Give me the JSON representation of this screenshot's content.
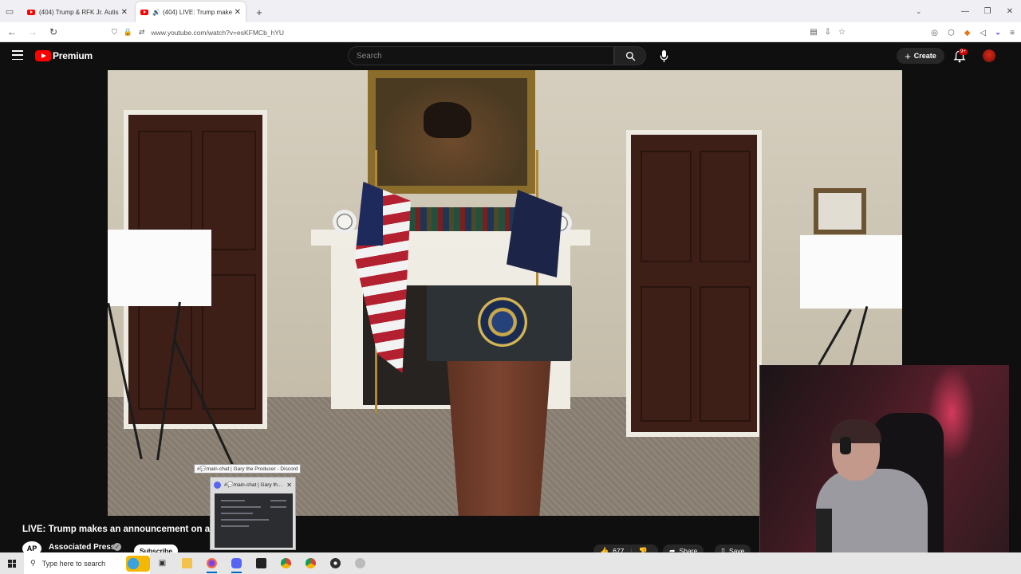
{
  "browser": {
    "tabs": [
      {
        "title": "(404) Trump & RFK Jr. Autism Ar",
        "active": false,
        "audio": false
      },
      {
        "title": "(404) LIVE: Trump makes an",
        "active": true,
        "audio": true
      }
    ],
    "url": "www.youtube.com/watch?v=esKFMCb_hYU"
  },
  "youtube": {
    "brand": "Premium",
    "search_placeholder": "Search",
    "create_label": "Create",
    "notifications_badge": "9+"
  },
  "video": {
    "title": "LIVE: Trump makes an announcement on a",
    "channel": "Associated Press",
    "channel_avatar_text": "AP",
    "subscribe_label": "Subscribe",
    "likes": "677",
    "share_label": "Share",
    "save_label": "Save"
  },
  "discord_preview": {
    "tooltip": "#💬main-chat | Gary the Producer - Discord",
    "header": "#💬main-chat | Gary th..."
  },
  "taskbar": {
    "search_placeholder": "Type here to search",
    "apps": [
      "file-explorer",
      "task-view",
      "file-manager",
      "firefox",
      "discord",
      "live-app",
      "chrome",
      "chrome-alt",
      "obs",
      "app-extra"
    ]
  },
  "colors": {
    "youtube_red": "#ff0000",
    "page_bg": "#0f0f0f",
    "discord": "#5865f2"
  }
}
